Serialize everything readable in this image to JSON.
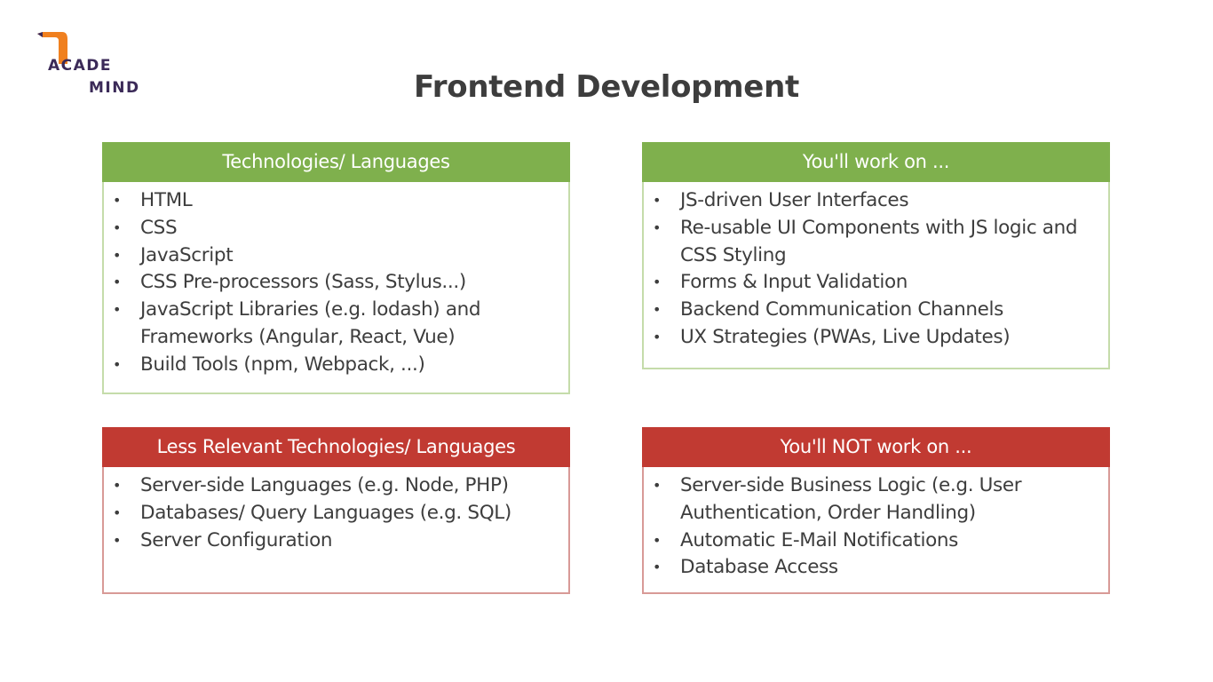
{
  "logo": {
    "line1": "ACADE",
    "line2": "MIND",
    "mark_color": "#f0801f",
    "text_color": "#3b2a58"
  },
  "title": "Frontend Development",
  "colors": {
    "green_header": "#7fb04d",
    "red_header": "#c13a32"
  },
  "boxes": {
    "tech": {
      "header": "Technologies/ Languages",
      "items": [
        "HTML",
        "CSS",
        "JavaScript",
        "CSS Pre-processors (Sass, Stylus...)",
        "JavaScript Libraries (e.g. lodash) and Frameworks (Angular, React, Vue)",
        "Build Tools (npm, Webpack, ...)"
      ]
    },
    "work": {
      "header": "You'll work on ...",
      "items": [
        "JS-driven User Interfaces",
        "Re-usable UI Components with JS logic and CSS Styling",
        "Forms & Input Validation",
        "Backend Communication Channels",
        "UX Strategies (PWAs, Live Updates)"
      ]
    },
    "less": {
      "header": "Less Relevant Technologies/ Languages",
      "items": [
        "Server-side Languages (e.g. Node, PHP)",
        "Databases/ Query Languages (e.g. SQL)",
        "Server Configuration"
      ]
    },
    "not": {
      "header": "You'll NOT work on ...",
      "items": [
        "Server-side Business Logic (e.g. User Authentication, Order Handling)",
        "Automatic E-Mail Notifications",
        "Database Access"
      ]
    }
  }
}
